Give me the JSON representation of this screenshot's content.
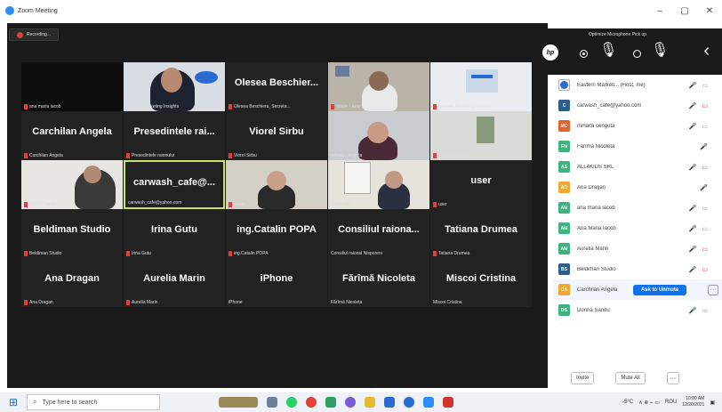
{
  "window": {
    "title": "Zoom Meeting",
    "minimize": "–",
    "maximize": "▢",
    "close": "✕"
  },
  "recording": {
    "label": "Recording..."
  },
  "hp_popup": {
    "title": "Optimize Microphone Pick up",
    "logo": "hp",
    "back": "‹"
  },
  "tiles": [
    {
      "big": "",
      "label": "ana maria iacob",
      "muted": true,
      "video": "dark"
    },
    {
      "big": "",
      "label": "Eastern Marketing Insights",
      "muted": false,
      "video": "man-blue"
    },
    {
      "big": "Olesea Beschier...",
      "label": "Olesea Beschieru, Secreta...",
      "muted": true,
      "video": ""
    },
    {
      "big": "",
      "label": "Vitalie Lazar",
      "muted": true,
      "video": "man-room"
    },
    {
      "big": "",
      "label": "Eastern Marketing Insights",
      "muted": true,
      "video": "slide"
    },
    {
      "big": "Carchilan Angela",
      "label": "Carchilan Angela",
      "muted": true,
      "video": ""
    },
    {
      "big": "Presedintele rai...",
      "label": "Presedintele raionului",
      "muted": true,
      "video": ""
    },
    {
      "big": "Viorel Sirbu",
      "label": "Viorel Sirbu",
      "muted": true,
      "video": ""
    },
    {
      "big": "",
      "label": "mihaita cenguta",
      "muted": false,
      "video": "woman"
    },
    {
      "big": "",
      "label": "Ana Maria Iacob",
      "muted": true,
      "video": "room-light"
    },
    {
      "big": "",
      "label": "Dorina Sandu",
      "muted": true,
      "video": "man-desk"
    },
    {
      "big": "carwash_cafe@...",
      "label": "carwash_cafe@yahoo.com",
      "muted": false,
      "video": "",
      "active": true
    },
    {
      "big": "",
      "label": "vlase",
      "muted": true,
      "video": "man-old"
    },
    {
      "big": "",
      "label": "Tudor Mitu",
      "muted": false,
      "video": "man-office"
    },
    {
      "big": "user",
      "label": "user",
      "muted": true,
      "video": ""
    },
    {
      "big": "Beldiman Studio",
      "label": "Beldiman Studio",
      "muted": true,
      "video": ""
    },
    {
      "big": "Irina Gutu",
      "label": "Irina Gutu",
      "muted": true,
      "video": ""
    },
    {
      "big": "ing.Catalin POPA",
      "label": "ing.Catalin POPA",
      "muted": true,
      "video": ""
    },
    {
      "big": "Consiliul raiona...",
      "label": "Consiliul raional Nisporeni",
      "muted": false,
      "video": ""
    },
    {
      "big": "Tatiana Drumea",
      "label": "Tatiana Drumea",
      "muted": true,
      "video": ""
    },
    {
      "big": "Ana Dragan",
      "label": "Ana Dragan",
      "muted": true,
      "video": ""
    },
    {
      "big": "Aurelia Marin",
      "label": "Aurelia Marin",
      "muted": true,
      "video": ""
    },
    {
      "big": "iPhone",
      "label": "iPhone",
      "muted": false,
      "video": ""
    },
    {
      "big": "Fărîmă Nicoleta",
      "label": "Fărîmă Nicoleta",
      "muted": false,
      "video": ""
    },
    {
      "big": "Miscoi Cristina",
      "label": "Miscoi Cristina",
      "muted": false,
      "video": ""
    }
  ],
  "participants": [
    {
      "initials": "",
      "name": "Eastern Marketi... (Host, me)",
      "color": "#ffffff",
      "mic": "on",
      "cam": "on",
      "photo": true
    },
    {
      "initials": "C",
      "name": "carwash_cafe@yahoo.com",
      "color": "#2e5f8a",
      "mic": "on",
      "cam": "off"
    },
    {
      "initials": "MC",
      "name": "mihaita cenguta",
      "color": "#e0632e",
      "mic": "on",
      "cam": "on"
    },
    {
      "initials": "FN",
      "name": "Fărîmă Nicoleta",
      "color": "#3fb27f",
      "mic": "on",
      "cam": ""
    },
    {
      "initials": "AS",
      "name": "ALL4KIDS SRL",
      "color": "#3fb27f",
      "mic": "off",
      "cam": "off"
    },
    {
      "initials": "AD",
      "name": "Ana Dragan",
      "color": "#f0a830",
      "mic": "off",
      "cam": ""
    },
    {
      "initials": "AM",
      "name": "ana maria iacob",
      "color": "#3fb27f",
      "mic": "off",
      "cam": "on"
    },
    {
      "initials": "AM",
      "name": "Ana Maria Iacob",
      "color": "#3fb27f",
      "mic": "off",
      "cam": "on"
    },
    {
      "initials": "AM",
      "name": "Aurelia Marin",
      "color": "#3fb27f",
      "mic": "off",
      "cam": "off"
    },
    {
      "initials": "BS",
      "name": "Beldiman Studio",
      "color": "#2e5f8a",
      "mic": "off",
      "cam": "off"
    },
    {
      "initials": "CA",
      "name": "Carchilan Angela",
      "color": "#f0a830",
      "mic": "",
      "cam": "",
      "ask": "Ask to Unmute",
      "more": "···"
    },
    {
      "initials": "DS",
      "name": "Dorina Sandu",
      "color": "#3fb27f",
      "mic": "off",
      "cam": "on"
    }
  ],
  "footer": {
    "invite": "Invite",
    "mute_all": "Mute All",
    "more": "···"
  },
  "taskbar": {
    "search_placeholder": "Type here to search",
    "temp": "-5°C",
    "lang": "ROU",
    "time": "10:00 AM",
    "date": "12/20/2021"
  }
}
